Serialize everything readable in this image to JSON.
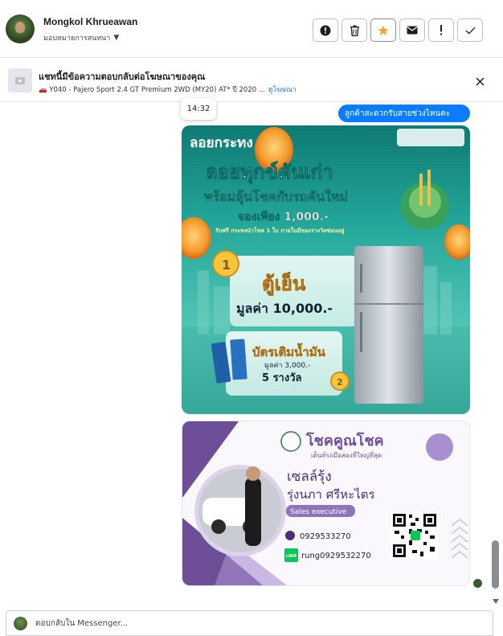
{
  "header": {
    "contact_name": "Mongkol Khrueawan",
    "assign_label": "มอบหมายการสนทนา",
    "toolbar": [
      {
        "name": "mark-important-button",
        "icon": "exclamation-circle-icon"
      },
      {
        "name": "delete-button",
        "icon": "trash-icon"
      },
      {
        "name": "star-button",
        "icon": "star-icon"
      },
      {
        "name": "mark-unread-button",
        "icon": "envelope-icon"
      },
      {
        "name": "spam-button",
        "icon": "exclamation-icon"
      },
      {
        "name": "done-button",
        "icon": "check-icon"
      }
    ],
    "star_color": "#f5a623"
  },
  "ad_bar": {
    "title": "แชทนี้มีข้อความตอบกลับต่อโฆษณาของคุณ",
    "subtitle": "🚗 Y040 - Pajero Sport 2.4 GT Premium 2WD (MY20) AT* ปี 2020 ...",
    "link_label": "ดูโฆษณา"
  },
  "chat": {
    "timestamp": "14:32",
    "message": "ลูกค้าสะดวกรับสายช่วงไหนคะ",
    "bubble_color": "#0a7cff",
    "promo_image": {
      "header_brand": "ลอยกระทง",
      "headline": "ลอยทุกข์คันเก่า",
      "subheadline": "พร้อมลุ้นโชคกับรถคันใหม่",
      "booking": "จองเพียง 1,000.-",
      "note": "รับฟรี กระทงนำโชค 1 ใบ ภายในมีของรางวัลซ่อนอยู่",
      "prize1_label": "ตู้เย็น",
      "prize1_value": "มูลค่า 10,000.-",
      "prize2_label": "บัตรเติมน้ำมัน",
      "prize2_value": "มูลค่า 3,000.-",
      "prize2_count": "5 รางวัล",
      "rank1": "1",
      "rank2": "2"
    },
    "business_card": {
      "brand": "โชคคูณโชค",
      "tagline": "เต็นท์รถมือสองที่ใหญ่ที่สุด",
      "nickname": "เซลล์รุ้ง",
      "fullname": "รุ่งนภา ศรีหะไตร",
      "role": "Sales executive",
      "phone": "0929533270",
      "line_badge": "LINE",
      "line_id": "rung0929532270"
    }
  },
  "composer": {
    "placeholder": "ตอบกลับใน Messenger..."
  }
}
